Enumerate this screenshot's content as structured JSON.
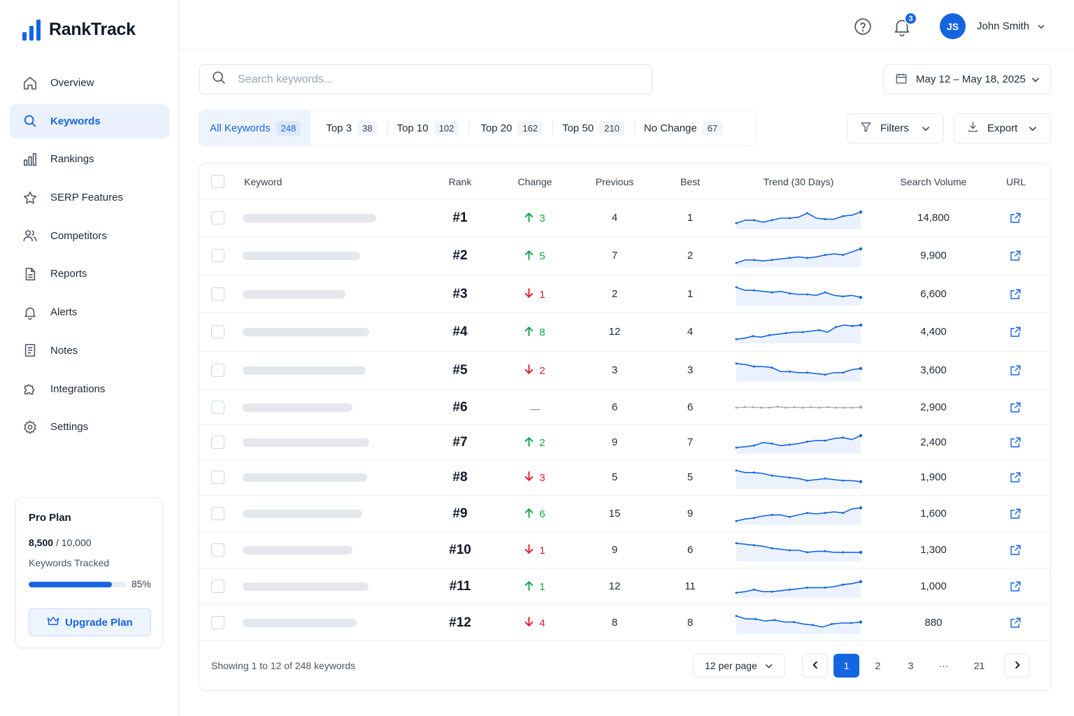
{
  "app": {
    "name": "RankTrack"
  },
  "nav": [
    {
      "label": "Overview",
      "icon": "home-icon"
    },
    {
      "label": "Keywords",
      "icon": "search-icon",
      "active": true
    },
    {
      "label": "Rankings",
      "icon": "bar-chart-icon"
    },
    {
      "label": "SERP Features",
      "icon": "star-icon"
    },
    {
      "label": "Competitors",
      "icon": "users-icon"
    },
    {
      "label": "Reports",
      "icon": "document-icon"
    },
    {
      "label": "Alerts",
      "icon": "bell-icon"
    },
    {
      "label": "Notes",
      "icon": "notes-icon"
    },
    {
      "label": "Integrations",
      "icon": "puzzle-icon"
    },
    {
      "label": "Settings",
      "icon": "gear-icon"
    }
  ],
  "plan": {
    "title": "Pro Plan",
    "used": "8,500",
    "limit": "/ 10,000",
    "subtitle": "Keywords Tracked",
    "percent_label": "85%",
    "percent": 85,
    "upgrade_label": "Upgrade Plan"
  },
  "header": {
    "notification_count": "3",
    "user_initials": "JS",
    "user_name": "John Smith"
  },
  "search": {
    "placeholder": "Search keywords..."
  },
  "date_range": "May 12 – May 18, 2025",
  "tabs": [
    {
      "label": "All Keywords",
      "count": "248",
      "active": true
    },
    {
      "label": "Top 3",
      "count": "38"
    },
    {
      "label": "Top 10",
      "count": "102"
    },
    {
      "label": "Top 20",
      "count": "162"
    },
    {
      "label": "Top 50",
      "count": "210"
    },
    {
      "label": "No Change",
      "count": "67"
    }
  ],
  "toolbar": {
    "filters_label": "Filters",
    "export_label": "Export"
  },
  "table": {
    "headers": {
      "keyword": "Keyword",
      "rank": "Rank",
      "change": "Change",
      "previous": "Previous",
      "best": "Best",
      "trend": "Trend (30 Days)",
      "volume": "Search Volume",
      "url": "URL"
    },
    "rows": [
      {
        "rank": "#1",
        "change": "3",
        "dir": "up",
        "previous": "4",
        "best": "1",
        "volume": "14,800",
        "trend": [
          10,
          13,
          13,
          11,
          13,
          15,
          15,
          16,
          20,
          15,
          14,
          14,
          17,
          18,
          21
        ]
      },
      {
        "rank": "#2",
        "change": "5",
        "dir": "up",
        "previous": "7",
        "best": "2",
        "volume": "9,900",
        "trend": [
          8,
          11,
          11,
          10,
          11,
          12,
          13,
          14,
          13,
          14,
          16,
          17,
          16,
          19,
          22
        ]
      },
      {
        "rank": "#3",
        "change": "1",
        "dir": "down",
        "previous": "2",
        "best": "1",
        "volume": "6,600",
        "trend": [
          22,
          19,
          19,
          18,
          17,
          18,
          16,
          15,
          15,
          14,
          17,
          14,
          13,
          14,
          12
        ]
      },
      {
        "rank": "#4",
        "change": "8",
        "dir": "up",
        "previous": "12",
        "best": "4",
        "volume": "4,400",
        "trend": [
          8,
          9,
          11,
          10,
          12,
          13,
          14,
          15,
          15,
          16,
          17,
          15,
          20,
          22,
          21,
          22
        ]
      },
      {
        "rank": "#5",
        "change": "2",
        "dir": "down",
        "previous": "3",
        "best": "3",
        "volume": "3,600",
        "trend": [
          22,
          21,
          19,
          19,
          18,
          14,
          14,
          13,
          13,
          12,
          11,
          13,
          13,
          16,
          17
        ]
      },
      {
        "rank": "#6",
        "change": "",
        "dir": "none",
        "previous": "6",
        "best": "6",
        "volume": "2,900",
        "trend": [
          15,
          15.5,
          15.5,
          15,
          15,
          16,
          15,
          15.5,
          15,
          15.5,
          15,
          15.5,
          15,
          15,
          15,
          15.5
        ]
      },
      {
        "rank": "#7",
        "change": "2",
        "dir": "up",
        "previous": "9",
        "best": "7",
        "volume": "2,400",
        "trend": [
          10,
          11,
          12,
          15,
          14,
          12,
          13,
          14,
          16,
          17,
          17,
          19,
          20,
          18,
          22
        ]
      },
      {
        "rank": "#8",
        "change": "3",
        "dir": "down",
        "previous": "5",
        "best": "5",
        "volume": "1,900",
        "trend": [
          22,
          20,
          20,
          19,
          17,
          16,
          15,
          14,
          12,
          13,
          14,
          13,
          12,
          12,
          11
        ]
      },
      {
        "rank": "#9",
        "change": "6",
        "dir": "up",
        "previous": "15",
        "best": "9",
        "volume": "1,600",
        "trend": [
          8,
          10,
          11,
          13,
          14,
          14,
          12,
          14,
          16,
          15,
          16,
          17,
          16,
          20,
          21
        ]
      },
      {
        "rank": "#10",
        "change": "1",
        "dir": "down",
        "previous": "9",
        "best": "6",
        "volume": "1,300",
        "trend": [
          22,
          21,
          20,
          19,
          17,
          16,
          15,
          15,
          13,
          14,
          14,
          13,
          13,
          13,
          13
        ]
      },
      {
        "rank": "#11",
        "change": "1",
        "dir": "up",
        "previous": "12",
        "best": "11",
        "volume": "1,000",
        "trend": [
          9,
          10,
          12,
          10,
          10,
          11,
          12,
          13,
          14,
          14,
          14,
          15,
          17,
          18,
          20
        ]
      },
      {
        "rank": "#12",
        "change": "4",
        "dir": "down",
        "previous": "8",
        "best": "8",
        "volume": "880",
        "trend": [
          22,
          19,
          19,
          17,
          18,
          16,
          16,
          14,
          13,
          11,
          14,
          15,
          15,
          16
        ]
      }
    ]
  },
  "footer": {
    "showing": "Showing 1 to 12 of 248 keywords",
    "per_page": "12 per page",
    "pages": [
      "1",
      "2",
      "3",
      "···",
      "21"
    ]
  }
}
